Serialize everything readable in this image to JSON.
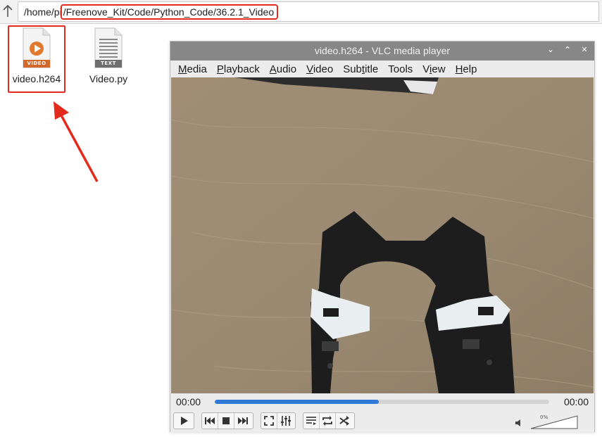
{
  "path_bar": {
    "prefix": "/home/pi",
    "highlighted": "/Freenove_Kit/Code/Python_Code/36.2.1_Video"
  },
  "files": [
    {
      "label": "video.h264",
      "badge": "VIDEO",
      "icon": "video-file-icon",
      "accent": "#e07a2e"
    },
    {
      "label": "Video.py",
      "badge": "TEXT",
      "icon": "text-file-icon",
      "accent": "#6e6e6e"
    }
  ],
  "vlc": {
    "title": "video.h264 - VLC media player",
    "menu": [
      {
        "label": "Media",
        "underline": "M"
      },
      {
        "label": "Playback",
        "underline": "P"
      },
      {
        "label": "Audio",
        "underline": "A"
      },
      {
        "label": "Video",
        "underline": "V"
      },
      {
        "label": "Subtitle",
        "underline": "t"
      },
      {
        "label": "Tools",
        "underline": "S"
      },
      {
        "label": "View",
        "underline": "i"
      },
      {
        "label": "Help",
        "underline": "H"
      }
    ],
    "time_elapsed": "00:00",
    "time_total": "00:00",
    "seek_progress_fraction": 0.49,
    "volume_label": "0%",
    "volume_level_fraction": 0.0
  },
  "colors": {
    "highlight_red": "#e32b1d",
    "titlebar": "#878787",
    "seek_fill": "#2f7ad6"
  }
}
